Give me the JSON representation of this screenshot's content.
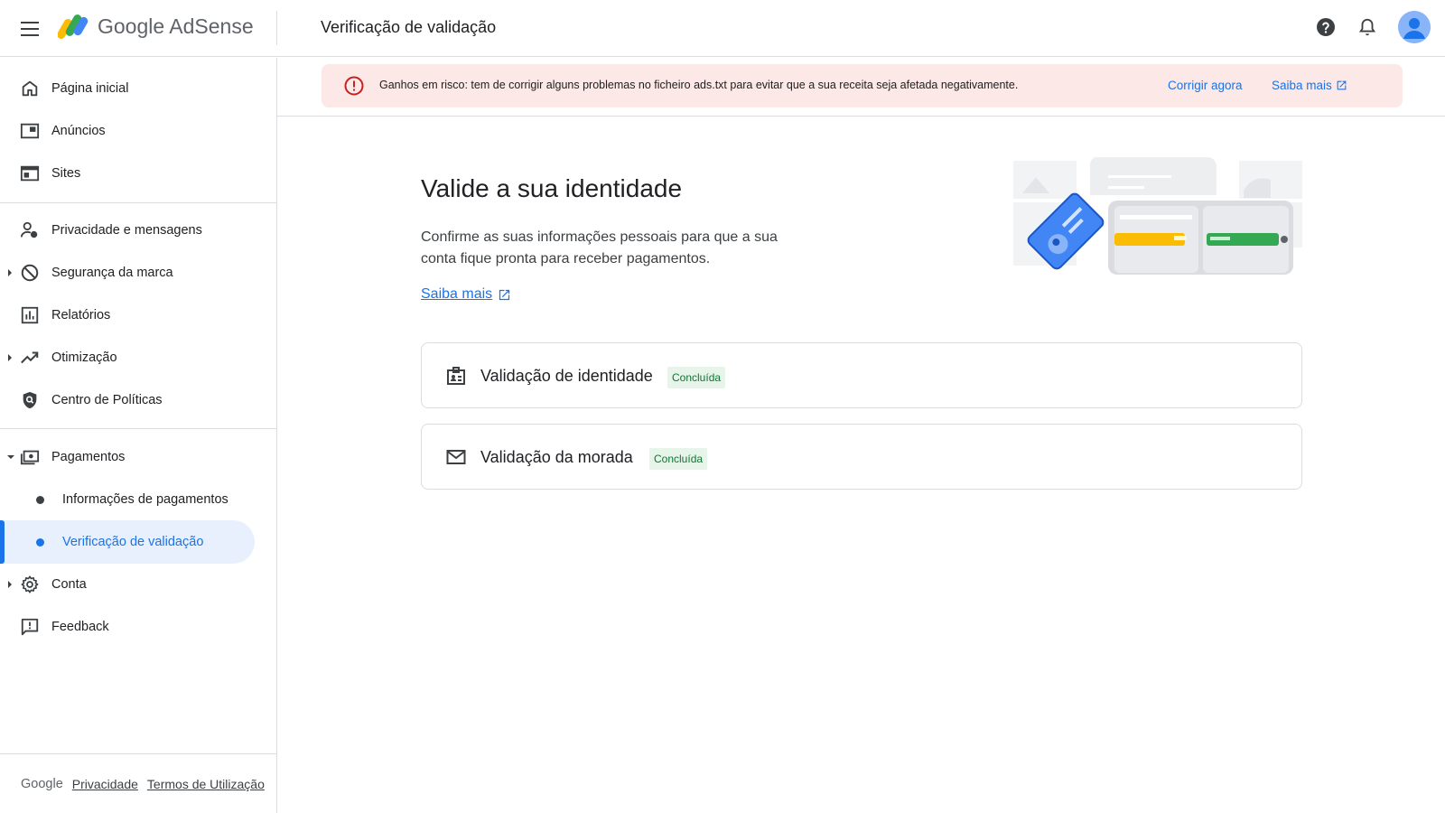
{
  "header": {
    "brand_google": "Google",
    "brand_product": "AdSense",
    "title": "Verificação de validação"
  },
  "sidebar": {
    "items": [
      {
        "label": "Página inicial",
        "icon": "home-icon"
      },
      {
        "label": "Anúncios",
        "icon": "ads-icon"
      },
      {
        "label": "Sites",
        "icon": "sites-icon"
      },
      {
        "label": "Privacidade e mensagens",
        "icon": "privacy-icon"
      },
      {
        "label": "Segurança da marca",
        "icon": "block-icon"
      },
      {
        "label": "Relatórios",
        "icon": "reports-icon"
      },
      {
        "label": "Otimização",
        "icon": "trending-icon"
      },
      {
        "label": "Centro de Políticas",
        "icon": "policy-icon"
      },
      {
        "label": "Pagamentos",
        "icon": "payments-icon"
      },
      {
        "label": "Informações de pagamentos"
      },
      {
        "label": "Verificação de validação"
      },
      {
        "label": "Conta",
        "icon": "gear-icon"
      },
      {
        "label": "Feedback",
        "icon": "feedback-icon"
      }
    ],
    "footer": {
      "brand": "Google",
      "privacy": "Privacidade",
      "terms": "Termos de Utilização"
    }
  },
  "alert": {
    "text": "Ganhos em risco: tem de corrigir alguns problemas no ficheiro ads.txt para evitar que a sua receita seja afetada negativamente.",
    "fix_label": "Corrigir agora",
    "learn_label": "Saiba mais",
    "color": "#fce8e6"
  },
  "main": {
    "title": "Valide a sua identidade",
    "description": "Confirme as suas informações pessoais para que a sua conta fique pronta para receber pagamentos.",
    "learn_more": "Saiba mais",
    "cards": [
      {
        "title": "Validação de identidade",
        "status": "Concluída",
        "icon": "id-card-icon"
      },
      {
        "title": "Validação da morada",
        "status": "Concluída",
        "icon": "mail-icon"
      }
    ]
  },
  "colors": {
    "accent": "#1a73e8",
    "active_bg": "#e8f0fe",
    "success_bg": "#e6f4ea",
    "success_text": "#137333",
    "error": "#c5221f"
  }
}
